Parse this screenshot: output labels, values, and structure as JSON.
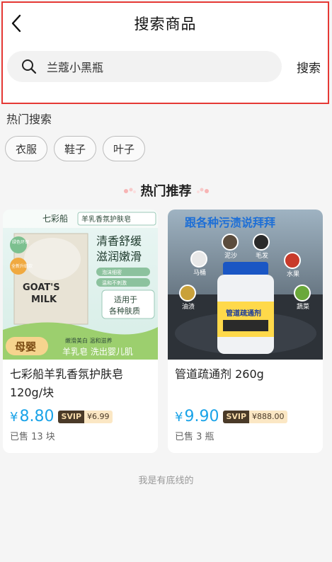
{
  "header": {
    "title": "搜索商品"
  },
  "search": {
    "value": "兰蔻小黑瓶",
    "button_label": "搜索"
  },
  "hot_search": {
    "title": "热门搜索",
    "tags": [
      "衣服",
      "鞋子",
      "叶子"
    ]
  },
  "recommend": {
    "title": "热门推荐"
  },
  "products": [
    {
      "name": "七彩船羊乳香氛护肤皂120g/块",
      "price": "8.80",
      "currency": "¥",
      "svip_label": "SVIP",
      "svip_price": "¥6.99",
      "sold": "已售 13 块",
      "image": {
        "brand": "七彩船",
        "subtitle": "羊乳香氛护肤皂",
        "slogan1": "清香舒缓",
        "slogan2": "滋润嫩滑",
        "tag1": "泡沫细密",
        "tag2": "温和不刺激",
        "box_text1": "GOAT'S",
        "box_text2": "MILK",
        "badge1": "绿色环保",
        "badge2": "全新升级款",
        "suit1": "适用于",
        "suit2": "各种肤质",
        "baby": "母婴",
        "bottom_small": "嫩滑美白 温和滋养",
        "bottom": "羊乳皂 洗出婴儿肌"
      }
    },
    {
      "name": "管道疏通剂 260g",
      "price": "9.90",
      "currency": "¥",
      "svip_label": "SVIP",
      "svip_price": "¥888.00",
      "sold": "已售 3 瓶",
      "image": {
        "headline": "跟各种污渍说拜拜",
        "c1": "泥沙",
        "c2": "毛发",
        "c3": "马桶",
        "c4": "水果",
        "c5": "油渍",
        "c6": "蔬菜",
        "bottle_label": "管道疏通剂"
      }
    }
  ],
  "footer": {
    "end_text": "我是有底线的"
  },
  "colors": {
    "accent_price": "#1aa3e8",
    "highlight_border": "#e53935"
  }
}
